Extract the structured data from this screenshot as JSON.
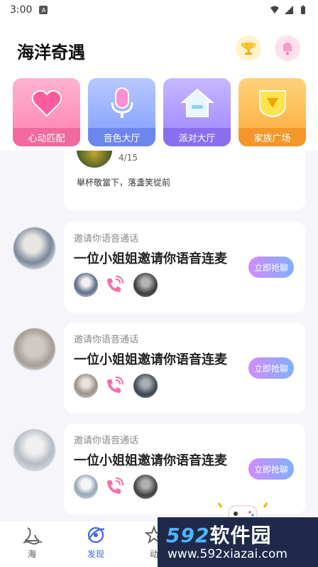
{
  "status_bar": {
    "time": "3:00"
  },
  "header": {
    "title": "海洋奇遇"
  },
  "categories": [
    {
      "label": "心动匹配",
      "icon": "heart-icon"
    },
    {
      "label": "音色大厅",
      "icon": "microphone-icon"
    },
    {
      "label": "派对大厅",
      "icon": "house-icon"
    },
    {
      "label": "家族广场",
      "icon": "shield-icon"
    }
  ],
  "post": {
    "date": "4/15",
    "caption": "舉杯敬當下，落盞笑從前"
  },
  "calls": [
    {
      "subtitle": "邀请你语音通话",
      "title": "一位小姐姐邀请你语音连麦",
      "button": "立即抢聊"
    },
    {
      "subtitle": "邀请你语音通话",
      "title": "一位小姐姐邀请你语音连麦",
      "button": "立即抢聊"
    },
    {
      "subtitle": "邀请你语音通话",
      "title": "一位小姐姐邀请你语音连麦",
      "button": "立即抢聊"
    }
  ],
  "bottom_nav": [
    {
      "label": "海",
      "icon": "sea-icon"
    },
    {
      "label": "发现",
      "icon": "discover-icon",
      "active": true
    },
    {
      "label": "动",
      "icon": "star-icon"
    }
  ],
  "watermark": {
    "brand_number": "592",
    "brand_text": "软件园",
    "url": "www.592xiazai.com"
  },
  "colors": {
    "accent": "#3f67e8",
    "call_button_start": "#d08bff",
    "call_button_end": "#7fb0ff"
  }
}
